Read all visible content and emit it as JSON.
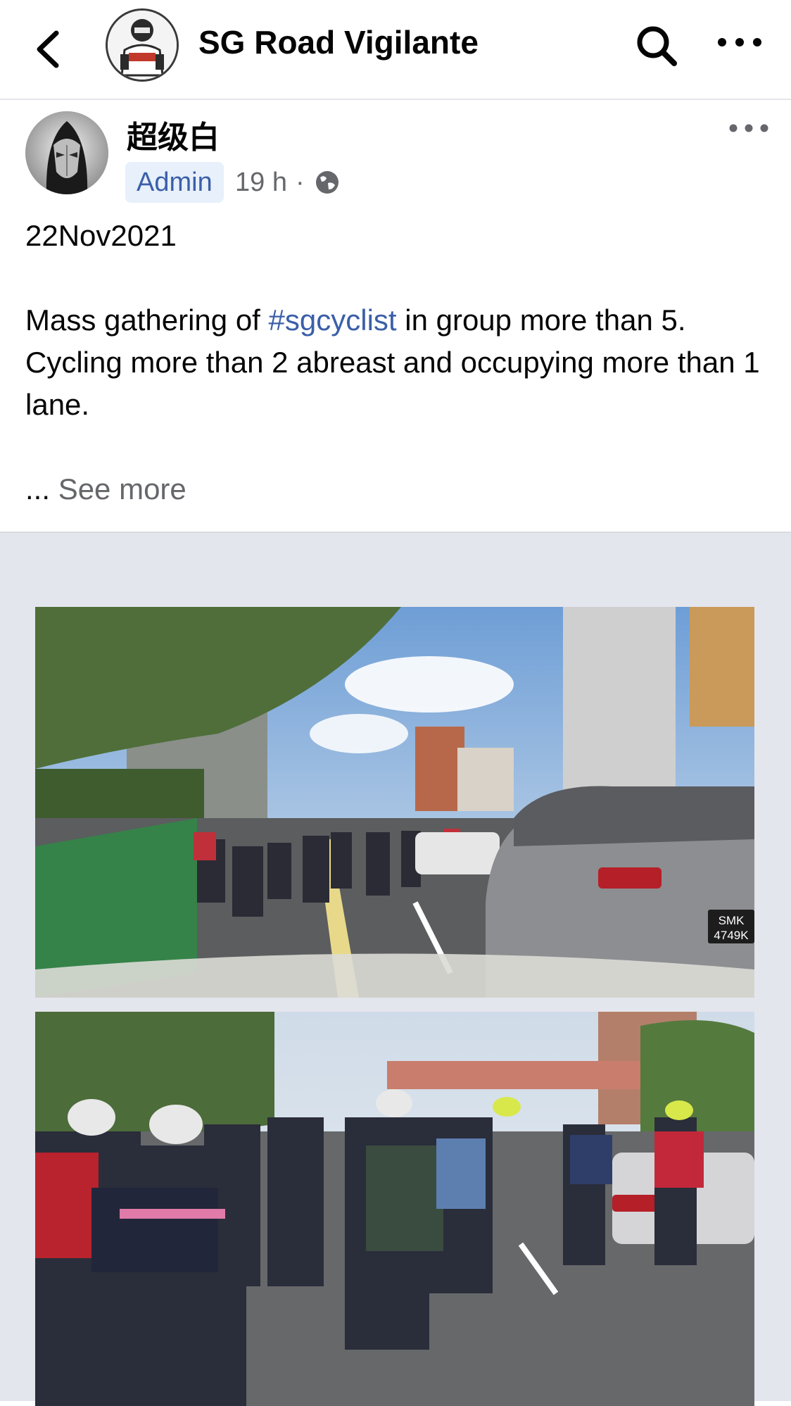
{
  "header": {
    "back_icon": "chevron-left-icon",
    "group_name": "SG Road Vigilante",
    "search_icon": "search-icon",
    "more_icon": "more-horizontal-icon"
  },
  "post": {
    "author_name": "超级白",
    "badge": "Admin",
    "time": "19 h",
    "separator": "·",
    "privacy_icon": "globe-icon",
    "text": {
      "line_date": "22Nov2021",
      "line1_prefix": "Mass gathering of ",
      "hashtag": "#sgcyclist",
      "line1_suffix": " in group more than 5.",
      "line2": "Cycling more than 2 abreast and occupying more than 1 lane."
    },
    "ellipsis": "...",
    "see_more": "See more",
    "photo1": {
      "plate_line1": "SMK",
      "plate_line2": "4749K"
    }
  },
  "colors": {
    "link_blue": "#3b5fa8",
    "badge_bg": "#e7f0fb",
    "muted_text": "#65676b",
    "media_bg": "#e4e6ed"
  }
}
